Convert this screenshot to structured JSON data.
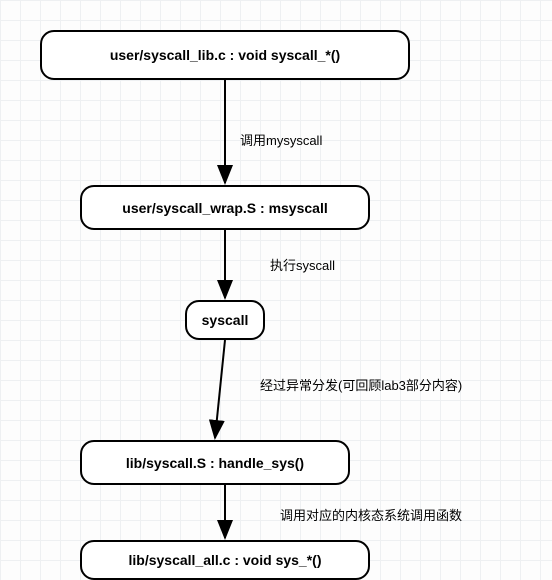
{
  "nodes": {
    "n1": "user/syscall_lib.c : void syscall_*()",
    "n2": "user/syscall_wrap.S : msyscall",
    "n3": "syscall",
    "n4": "lib/syscall.S : handle_sys()",
    "n5": "lib/syscall_all.c : void sys_*()"
  },
  "edges": {
    "e1": "调用mysyscall",
    "e2": "执行syscall",
    "e3": "经过异常分发(可回顾lab3部分内容)",
    "e4": "调用对应的内核态系统调用函数"
  }
}
